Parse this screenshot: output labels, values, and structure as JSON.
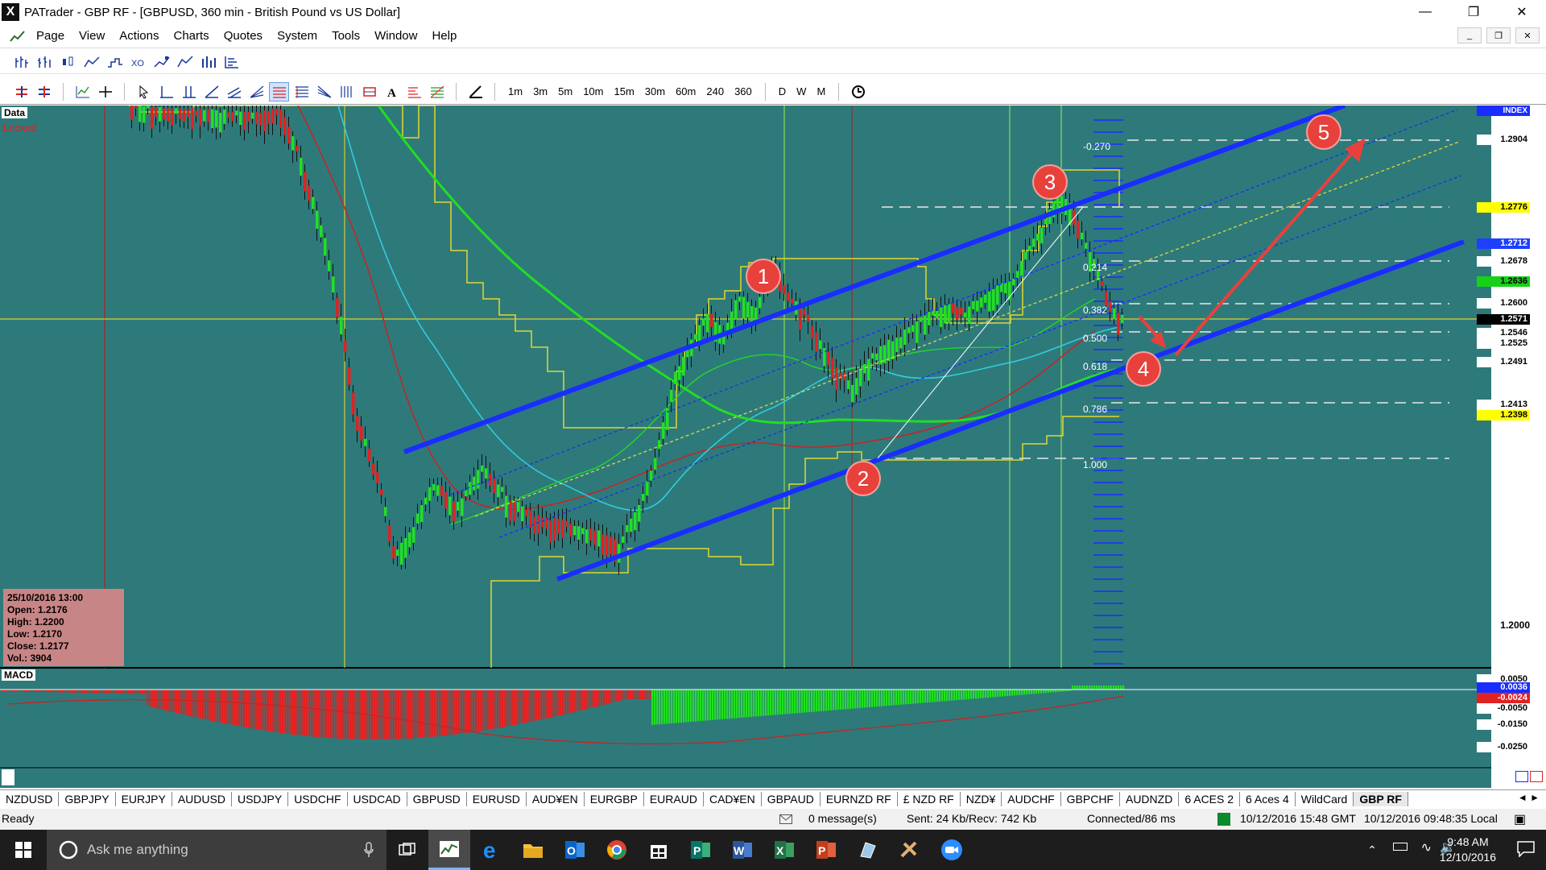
{
  "window": {
    "title": "PATrader - GBP RF - [GBPUSD, 360 min - British Pound vs US Dollar]",
    "app_letter": "X"
  },
  "menu": [
    "Page",
    "View",
    "Actions",
    "Charts",
    "Quotes",
    "System",
    "Tools",
    "Window",
    "Help"
  ],
  "timeframes": [
    "1m",
    "3m",
    "5m",
    "10m",
    "15m",
    "30m",
    "60m",
    "240",
    "360",
    "D",
    "W",
    "M"
  ],
  "chart": {
    "data_label": "Data",
    "locked_label": "Locked",
    "index_label": "INDEX",
    "macd_label": "MACD",
    "ohlc": {
      "date": "25/10/2016 13:00",
      "open": "Open: 1.2176",
      "high": "High: 1.2200",
      "low": "Low: 1.2170",
      "close": "Close: 1.2177",
      "vol": "Vol.: 3904"
    },
    "price_tags": [
      {
        "text": "1.2904",
        "bg": "#ffffff",
        "fg": "#000000"
      },
      {
        "text": "1.2776",
        "bg": "#ffff00",
        "fg": "#000000"
      },
      {
        "text": "1.2712",
        "bg": "#1f3fff",
        "fg": "#ffffff"
      },
      {
        "text": "1.2678",
        "bg": "#ffffff",
        "fg": "#000000"
      },
      {
        "text": "1.2636",
        "bg": "#18d018",
        "fg": "#000000"
      },
      {
        "text": "1.2600",
        "bg": "#ffffff",
        "fg": "#000000"
      },
      {
        "text": "1.2571",
        "bg": "#000000",
        "fg": "#ffffff"
      },
      {
        "text": "1.2546",
        "bg": "#ffffff",
        "fg": "#000000"
      },
      {
        "text": "1.2525",
        "bg": "#ffffff",
        "fg": "#000000"
      },
      {
        "text": "1.2491",
        "bg": "#ffffff",
        "fg": "#000000"
      },
      {
        "text": "1.2413",
        "bg": "#ffffff",
        "fg": "#000000"
      },
      {
        "text": "1.2398",
        "bg": "#ffff00",
        "fg": "#000000"
      }
    ],
    "axis_label_low": "1.2000",
    "fib_levels": [
      "-0.270",
      "0.214",
      "0.382",
      "0.500",
      "0.618",
      "0.786",
      "1.000"
    ],
    "macd_tags": [
      "0.0050",
      "0.0036",
      "-0.0024",
      "-0.0050",
      "-0.0150",
      "-0.0250"
    ],
    "markers": [
      "1",
      "2",
      "3",
      "4",
      "5"
    ],
    "colors": {
      "background": "#2e7a7b",
      "channel": "#1a2dff",
      "bull": "#22e022",
      "bear": "#e02222",
      "annotation": "#e8413c"
    }
  },
  "symbol_tabs": [
    "NZDUSD",
    "GBPJPY",
    "EURJPY",
    "AUDUSD",
    "USDJPY",
    "USDCHF",
    "USDCAD",
    "GBPUSD",
    "EURUSD",
    "AUD¥EN",
    "EURGBP",
    "EURAUD",
    "CAD¥EN",
    "GBPAUD",
    "EURNZD RF",
    "£ NZD RF",
    "NZD¥",
    "AUDCHF",
    "GBPCHF",
    "AUDNZD",
    "6 ACES 2",
    "6 Aces 4",
    "WildCard",
    "GBP RF"
  ],
  "active_tab": "GBP RF",
  "status": {
    "ready": "Ready",
    "messages": "0 message(s)",
    "traffic": "Sent: 24 Kb/Recv: 742 Kb",
    "connection": "Connected/86 ms",
    "gmt": "10/12/2016 15:48 GMT",
    "local": "10/12/2016 09:48:35 Local"
  },
  "taskbar": {
    "search_placeholder": "Ask me anything",
    "time": "9:48 AM",
    "date": "12/10/2016"
  }
}
